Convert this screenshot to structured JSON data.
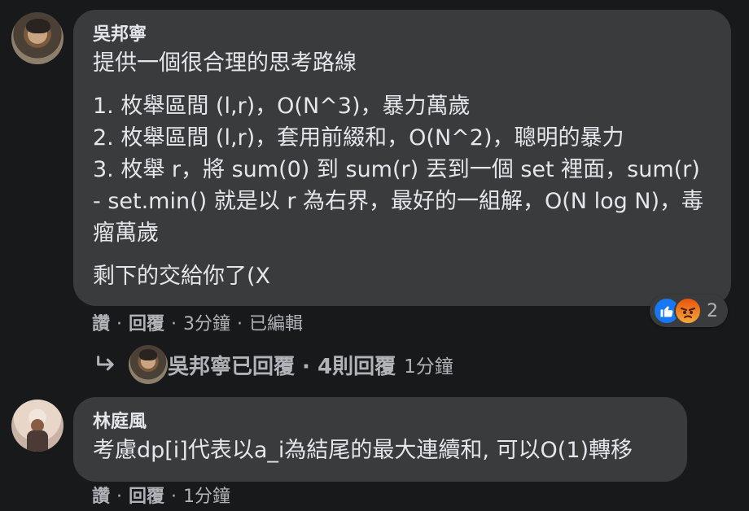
{
  "comments": [
    {
      "author": "吳邦寧",
      "paragraphs": [
        "提供一個很合理的思考路線",
        "1. 枚舉區間 (l,r)，O(N^3)，暴力萬歲\n2. 枚舉區間 (l,r)，套用前綴和，O(N^2)，聰明的暴力\n3. 枚舉 r，將 sum(0) 到 sum(r) 丟到一個 set 裡面，sum(r) - set.min() 就是以 r 為右界，最好的一組解，O(N log N)，毒瘤萬歲",
        "剩下的交給你了(X"
      ],
      "actions": {
        "like": "讚",
        "reply": "回覆",
        "time": "3分鐘",
        "edited": "已編輯"
      },
      "reactions": {
        "icons": [
          "like-icon",
          "angry-icon"
        ],
        "count": "2",
        "colors": {
          "like": "#1877f2",
          "angry": "#e9530b"
        }
      },
      "reply_summary": {
        "text": "吳邦寧已回覆 · 4則回覆",
        "time": "1分鐘"
      }
    },
    {
      "author": "林庭風",
      "paragraphs": [
        "考慮dp[i]代表以a_i為結尾的最大連續和, 可以O(1)轉移"
      ],
      "actions": {
        "like": "讚",
        "reply": "回覆",
        "time": "1分鐘"
      }
    }
  ],
  "separator": "·",
  "theme": {
    "background": "#18191a",
    "bubble": "#3a3b3c",
    "text": "#e4e6eb",
    "muted": "#b0b3b8"
  }
}
